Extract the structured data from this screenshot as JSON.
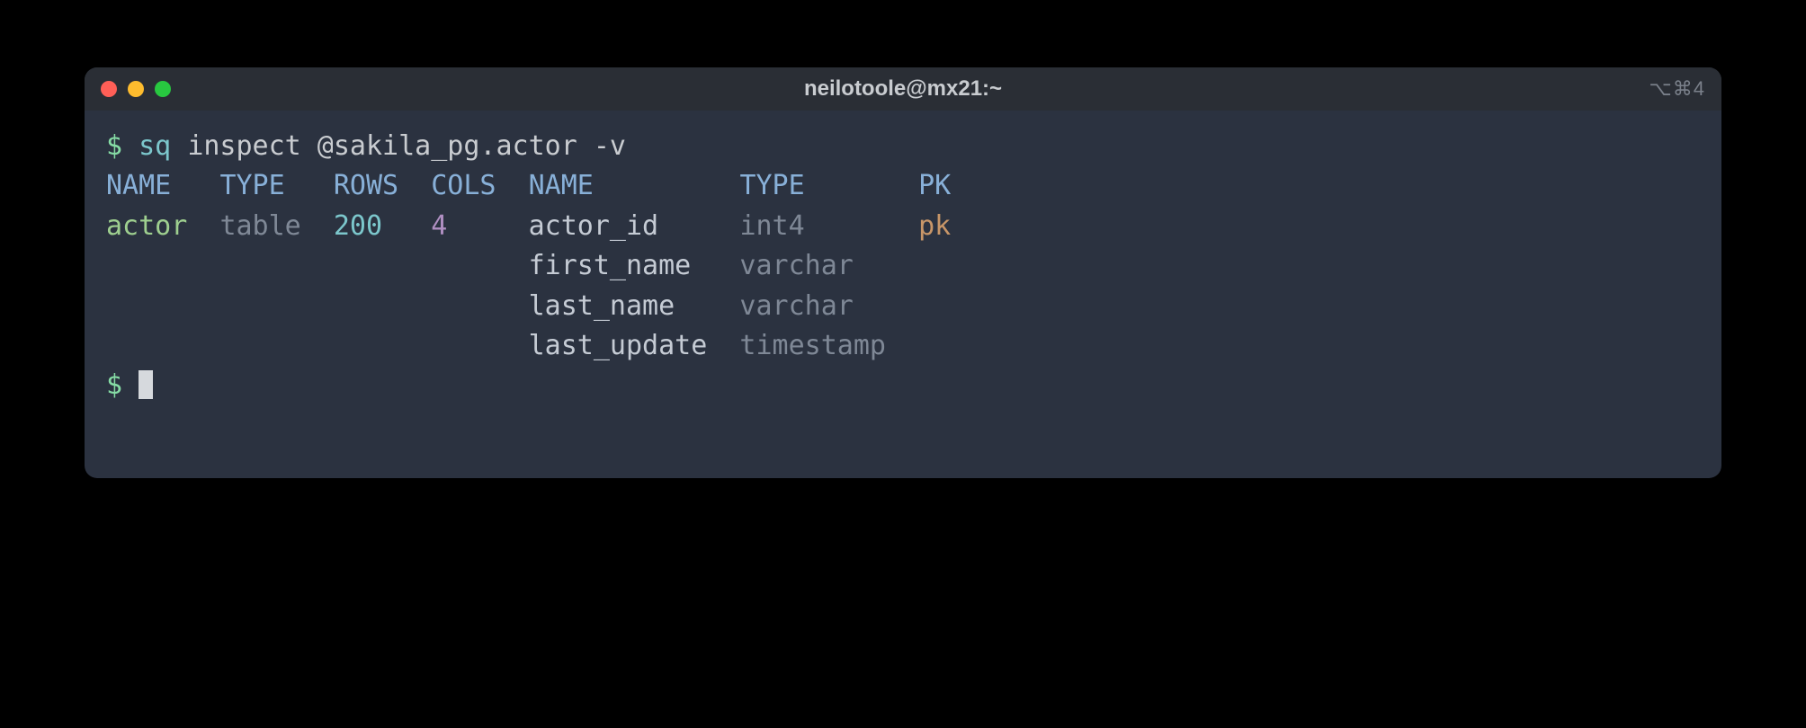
{
  "window": {
    "title": "neilotoole@mx21:~",
    "tab_indicator": "⌥⌘4"
  },
  "colors": {
    "red": "#ff5f57",
    "yellow": "#febc2e",
    "green": "#28c840",
    "bg": "#2b3240",
    "titlebar": "#2a2e35"
  },
  "prompt": "$",
  "command": {
    "bin": "sq",
    "args": "inspect @sakila_pg.actor -v"
  },
  "headers": {
    "name1": "NAME",
    "type1": "TYPE",
    "rows": "ROWS",
    "cols": "COLS",
    "name2": "NAME",
    "type2": "TYPE",
    "pk": "PK"
  },
  "table": {
    "name": "actor",
    "type": "table",
    "rows": "200",
    "cols": "4"
  },
  "columns": [
    {
      "name": "actor_id",
      "type": "int4",
      "pk": "pk"
    },
    {
      "name": "first_name",
      "type": "varchar",
      "pk": ""
    },
    {
      "name": "last_name",
      "type": "varchar",
      "pk": ""
    },
    {
      "name": "last_update",
      "type": "timestamp",
      "pk": ""
    }
  ]
}
